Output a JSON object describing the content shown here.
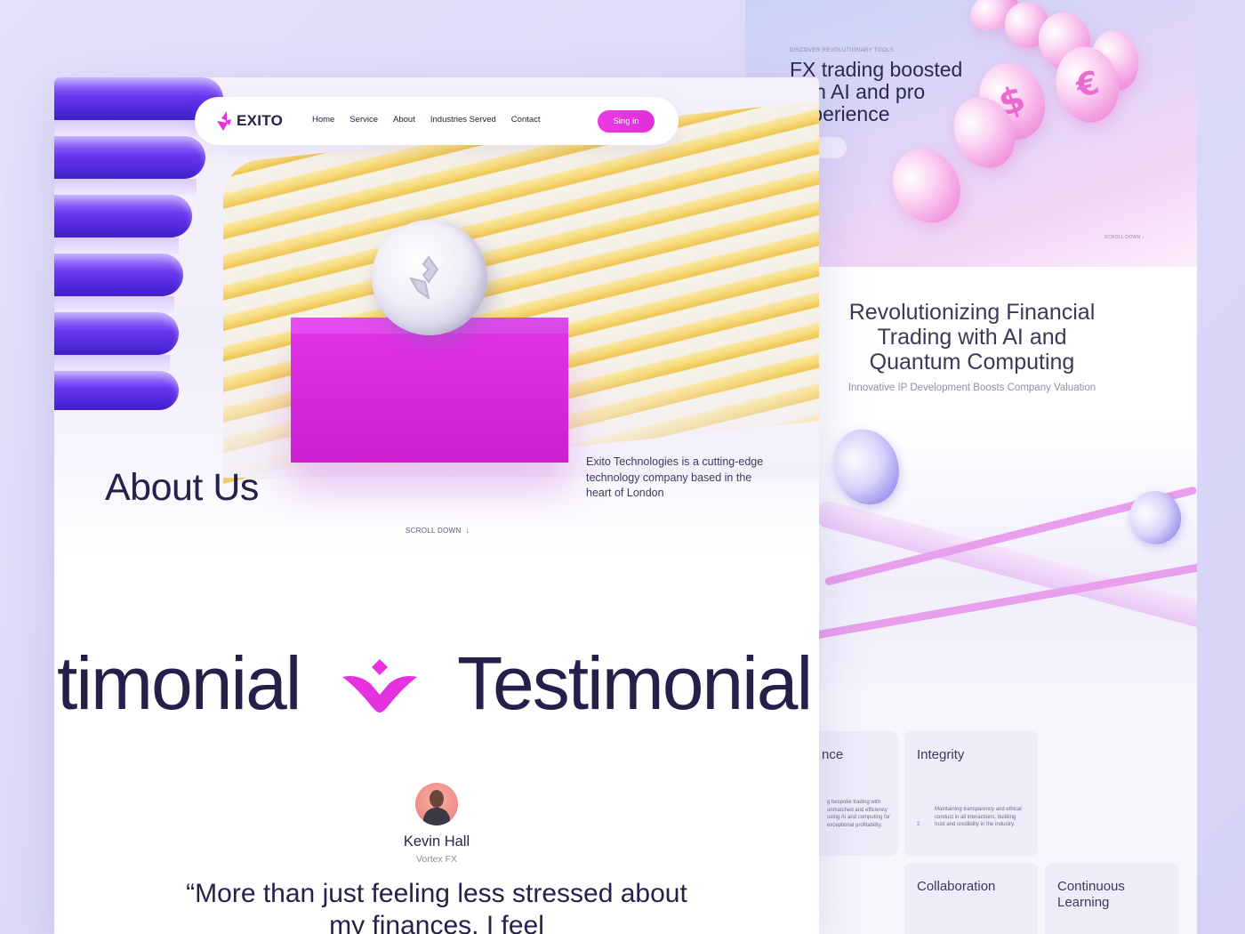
{
  "colors": {
    "brand_pink": "#e532de",
    "ink": "#24224b",
    "accent_purple": "#6a36ef"
  },
  "nav": {
    "logo_text": "EXITO",
    "links": [
      "Home",
      "Service",
      "About",
      "Industries Served",
      "Contact"
    ],
    "signin_label": "Sing in"
  },
  "hero": {
    "title": "About Us",
    "description": "Exito Technologies is a cutting-edge technology company based in the heart of London",
    "scroll_label": "SCROLL DOWN"
  },
  "marquee": {
    "left_text": "timonial",
    "right_text": "Testimonial"
  },
  "testimonial": {
    "name": "Kevin Hall",
    "company": "Vortex FX",
    "quote": "“More than just feeling less stressed about my finances, I feel"
  },
  "back_page": {
    "eyebrow": "DISCOVER REVOLUTIONARY TOOLS",
    "hero_title": "FX trading boosted with AI and pro experience",
    "scroll_label": "SCROLL DOWN",
    "section_title": "Revolutionizing Financial Trading with AI and Quantum Computing",
    "section_subtitle": "Innovative IP Development Boosts Company Valuation",
    "coin_symbols": [
      "$",
      "€"
    ],
    "values": [
      {
        "title": "nce",
        "text": "g bespoke trading with unmatched and efficiency using AI and computing for exceptional profitability."
      },
      {
        "title": "Integrity",
        "text": "Maintaining transparency and ethical conduct in all interactions, building trust and credibility in the industry.",
        "num": "2"
      },
      {
        "title": "Collaboration"
      },
      {
        "title": "Continuous Learning"
      }
    ]
  }
}
